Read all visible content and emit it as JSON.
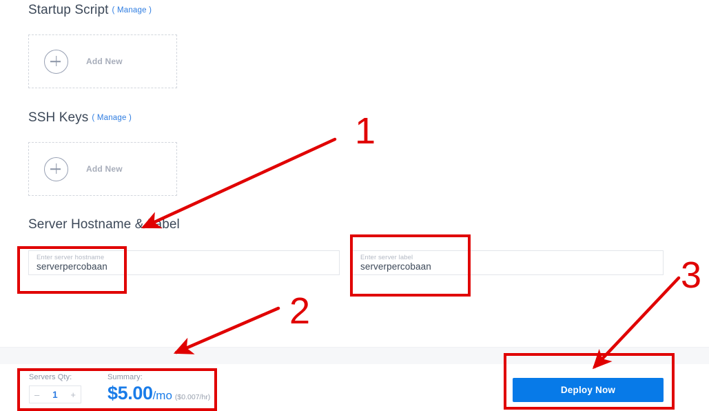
{
  "sections": [
    {
      "id": "startup-script",
      "title": "Startup Script",
      "manage_label": "( Manage )",
      "add_new_label": "Add New"
    },
    {
      "id": "ssh-keys",
      "title": "SSH Keys",
      "manage_label": "( Manage )",
      "add_new_label": "Add New"
    },
    {
      "id": "server-hostname-label",
      "title": "Server Hostname & Label"
    }
  ],
  "fields": {
    "hostname": {
      "placeholder": "Enter server hostname",
      "value": "serverpercobaan"
    },
    "label": {
      "placeholder": "Enter server label",
      "value": "serverpercobaan"
    }
  },
  "footer": {
    "qty_caption": "Servers Qty:",
    "qty_value": "1",
    "minus_glyph": "–",
    "plus_glyph": "+",
    "summary_caption": "Summary:",
    "price_main": "$5.00",
    "price_per": "/mo",
    "price_hourly": "($0.007/hr)",
    "deploy_label": "Deploy Now"
  },
  "annotations": {
    "markers": [
      {
        "id": "marker-1",
        "text": "1"
      },
      {
        "id": "marker-2",
        "text": "2"
      },
      {
        "id": "marker-3",
        "text": "3"
      }
    ],
    "accent_color": "#e00000"
  },
  "colors": {
    "brand_blue": "#077ae8",
    "link_blue": "#2f7de1",
    "text_dark": "#3c4858",
    "text_muted": "#8a94a6",
    "annotation_red": "#e00000"
  }
}
